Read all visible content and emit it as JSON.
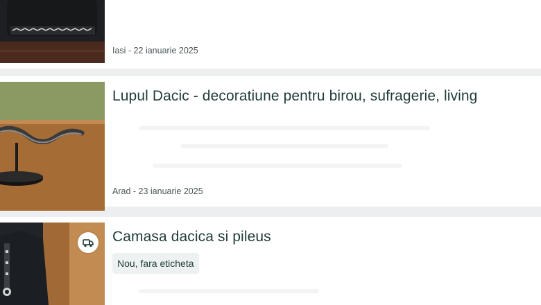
{
  "listings": [
    {
      "title": "",
      "location_date": "Iasi - 22 ianuarie 2025",
      "image_icon": "embroidered-fabric-image"
    },
    {
      "title": "Lupul Dacic - decoratiune pentru birou, sufragerie, living",
      "location_date": "Arad - 23 ianuarie 2025",
      "image_icon": "wolf-figurine-image"
    },
    {
      "title": "Camasa dacica si pileus",
      "condition_badge": "Nou, fara eticheta",
      "image_icon": "shirt-image",
      "delivery_icon": "delivery-truck-icon"
    }
  ],
  "colors": {
    "title_text": "#1f3b3a",
    "meta_text": "#4a5557",
    "card_background": "#ffffff",
    "page_background": "#eceeef",
    "badge_background": "#eef1f1"
  }
}
